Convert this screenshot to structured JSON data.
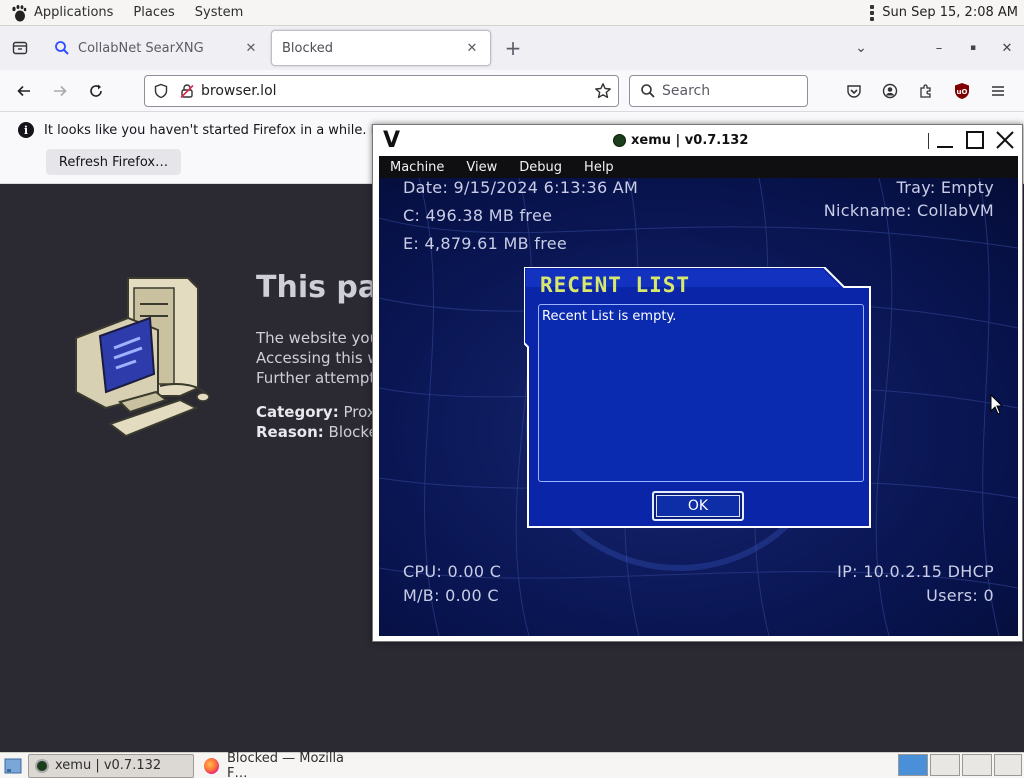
{
  "top_panel": {
    "applications": "Applications",
    "places": "Places",
    "system": "System",
    "clock": "Sun Sep 15,  2:08 AM"
  },
  "firefox": {
    "tabs": [
      {
        "title": "CollabNet SearXNG",
        "active": false
      },
      {
        "title": "Blocked",
        "active": true
      }
    ],
    "url": "browser.lol",
    "search_placeholder": "Search",
    "notification": {
      "message": "It looks like you haven't started Firefox in a while. Do yo",
      "refresh_button": "Refresh Firefox…"
    },
    "page": {
      "title": "This pag",
      "line1": "The website you",
      "line2": "Accessing this w",
      "line3": "Further attempt",
      "category_label": "Category:",
      "category_value": "Proxy",
      "reason_label": "Reason:",
      "reason_value": "Blocked"
    }
  },
  "xemu": {
    "window_title": "xemu | v0.7.132",
    "menu": [
      "Machine",
      "View",
      "Debug",
      "Help"
    ],
    "hud": {
      "date": "Date: 9/15/2024 6:13:36 AM",
      "drive_c": "C: 496.38 MB free",
      "drive_e": "E: 4,879.61 MB free",
      "tray": "Tray: Empty",
      "nickname": "Nickname: CollabVM",
      "cpu": "CPU: 0.00 C",
      "mb": "M/B: 0.00 C",
      "ip": "IP: 10.0.2.15 DHCP",
      "users": "Users: 0"
    },
    "dialog": {
      "title": "RECENT LIST",
      "message": "Recent List is empty.",
      "ok": "OK"
    },
    "colors": {
      "hud_text": "#c9cde6",
      "dialog_title": "#d8e86a",
      "dialog_bg": "#0a2ab0"
    }
  },
  "taskbar": {
    "items": [
      {
        "label": "xemu | v0.7.132",
        "active": true
      },
      {
        "label": "Blocked — Mozilla F…",
        "active": false
      }
    ]
  }
}
